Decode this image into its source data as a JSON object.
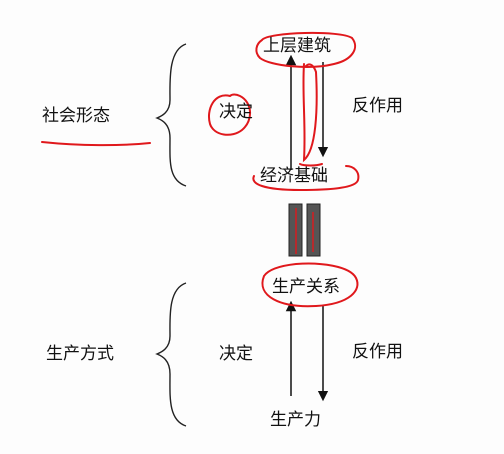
{
  "diagram": {
    "upper_group": {
      "category": "社会形态",
      "top_node": "上层建筑",
      "bottom_node": "经济基础",
      "left_relation": "决定",
      "right_relation": "反作用"
    },
    "lower_group": {
      "category": "生产方式",
      "top_node": "生产关系",
      "bottom_node": "生产力",
      "left_relation": "决定",
      "right_relation": "反作用"
    },
    "colors": {
      "ink": "#111111",
      "annotation": "#e0181c",
      "connector_fill": "#555555"
    }
  }
}
